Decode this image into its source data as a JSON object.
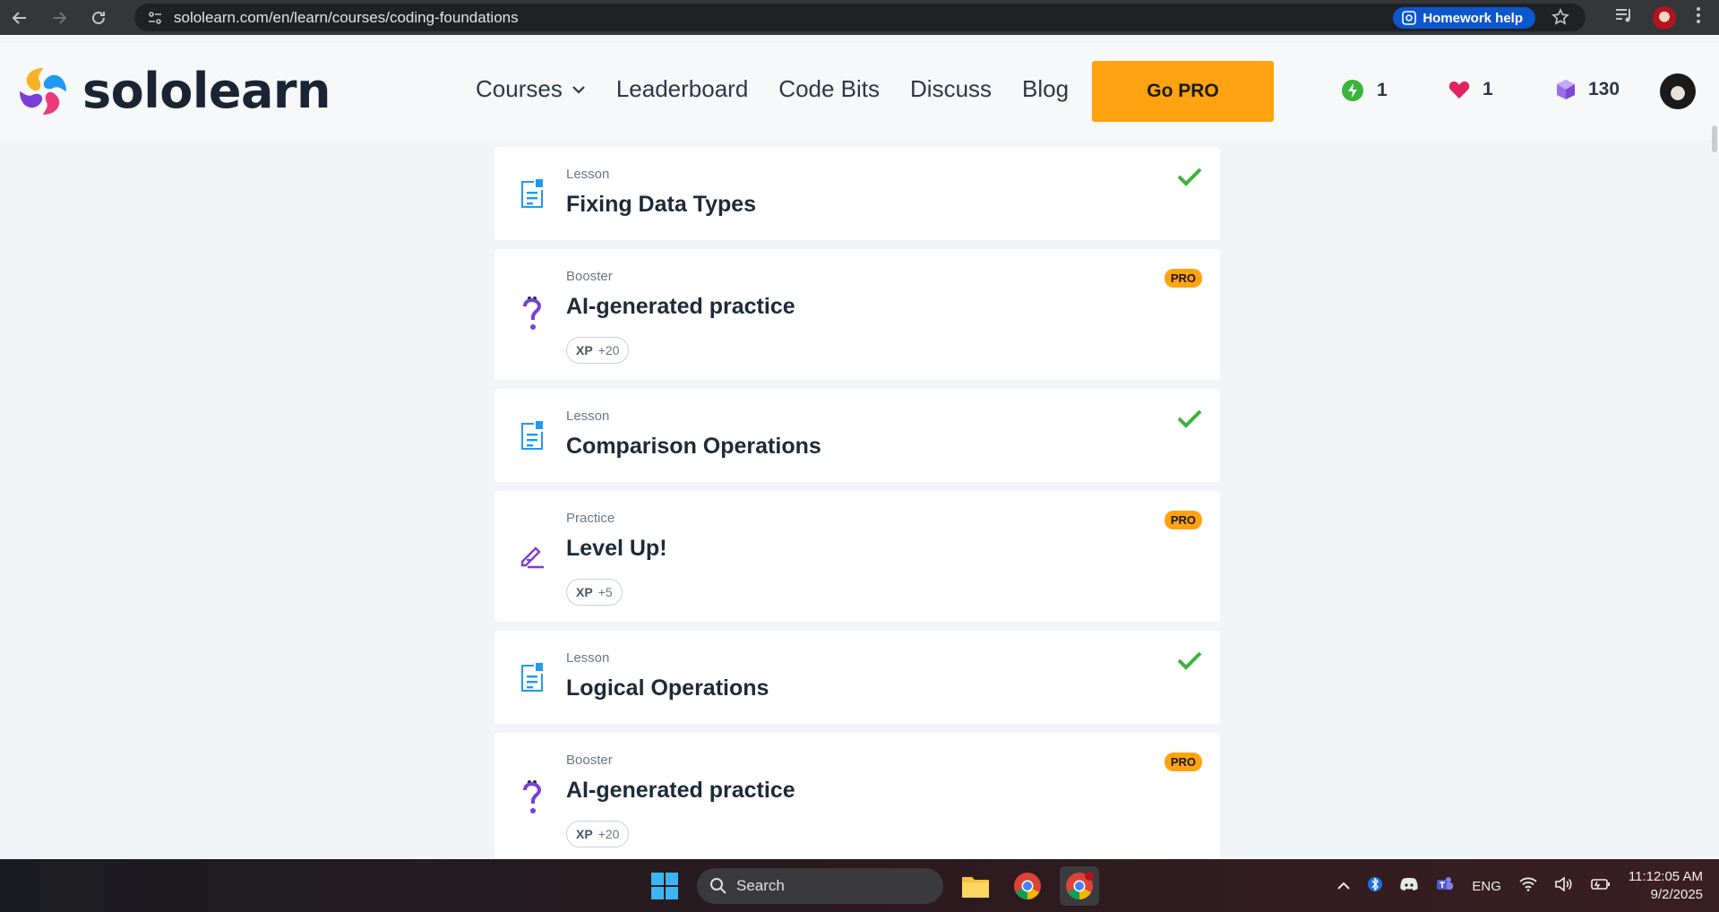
{
  "browser": {
    "url": "sololearn.com/en/learn/courses/coding-foundations",
    "homework_help": "Homework help"
  },
  "header": {
    "logo_text": "sololearn",
    "nav": [
      "Courses",
      "Leaderboard",
      "Code Bits",
      "Discuss",
      "Blog"
    ],
    "go_pro": "Go PRO",
    "streak": "1",
    "hearts": "1",
    "gems": "130"
  },
  "lessons": [
    {
      "kind": "Lesson",
      "title": "Fixing Data Types",
      "status": "completed"
    },
    {
      "kind": "Booster",
      "title": "AI-generated practice",
      "badge": "PRO",
      "xp_label": "XP",
      "xp_value": "+20"
    },
    {
      "kind": "Lesson",
      "title": "Comparison Operations",
      "status": "completed"
    },
    {
      "kind": "Practice",
      "title": "Level Up!",
      "badge": "PRO",
      "xp_label": "XP",
      "xp_value": "+5"
    },
    {
      "kind": "Lesson",
      "title": "Logical Operations",
      "status": "completed"
    },
    {
      "kind": "Booster",
      "title": "AI-generated practice",
      "badge": "PRO",
      "xp_label": "XP",
      "xp_value": "+20"
    }
  ],
  "taskbar": {
    "search_placeholder": "Search",
    "language": "ENG",
    "time": "11:12:05 AM",
    "date": "9/2/2025"
  },
  "colors": {
    "accent_orange": "#ffa310",
    "check_green": "#3cb43c",
    "lesson_blue": "#1d9bf0",
    "booster_purple": "#7b3fd6"
  }
}
